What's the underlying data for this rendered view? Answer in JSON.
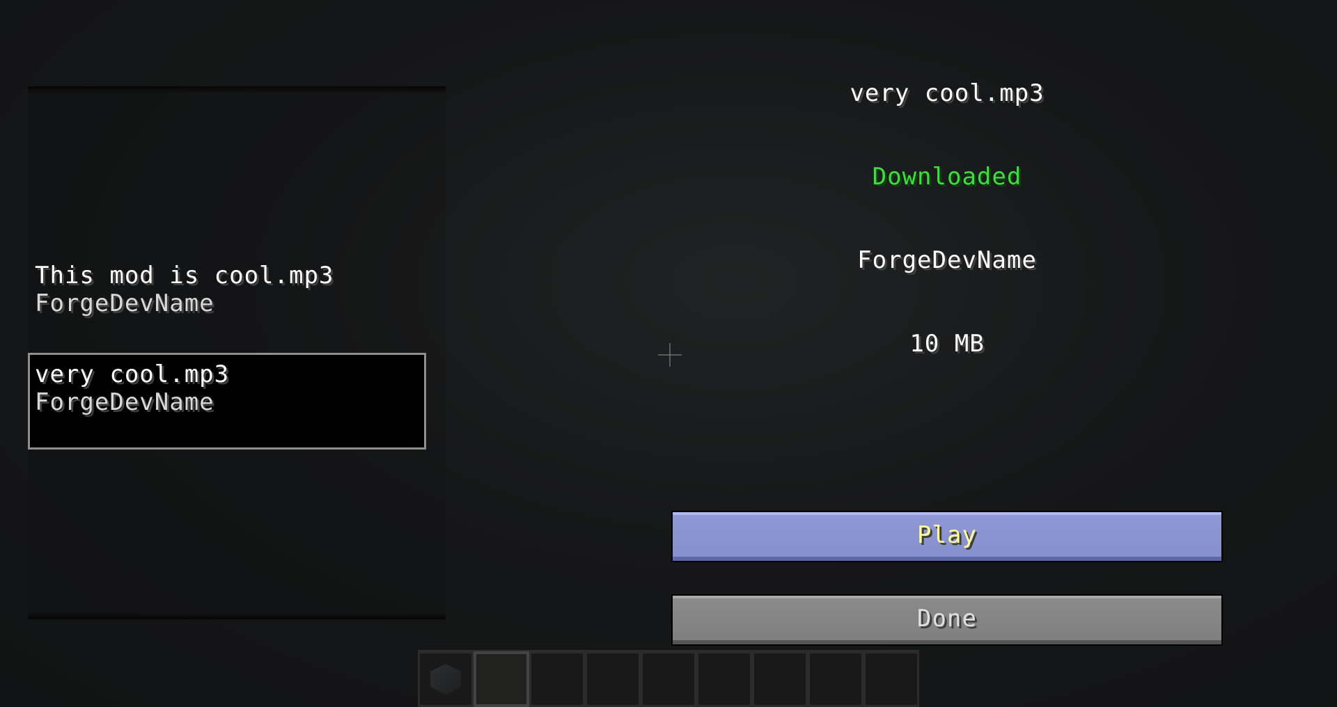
{
  "mod_list": {
    "entries": [
      {
        "title": "This mod is cool.mp3",
        "author": "ForgeDevName"
      },
      {
        "title": "very cool.mp3",
        "author": "ForgeDevName",
        "selected": true
      }
    ]
  },
  "details": {
    "title": "very cool.mp3",
    "status": "Downloaded",
    "author": "ForgeDevName",
    "size": "10 MB"
  },
  "buttons": {
    "play_label": "Play",
    "done_label": "Done"
  },
  "hotbar": {
    "slot_count": 9,
    "selected_slot": 2
  },
  "colors": {
    "status_downloaded": "#3ede3e",
    "play_button": "#8690cd",
    "play_text": "#ffffa0",
    "done_button": "#7f7f7f"
  }
}
